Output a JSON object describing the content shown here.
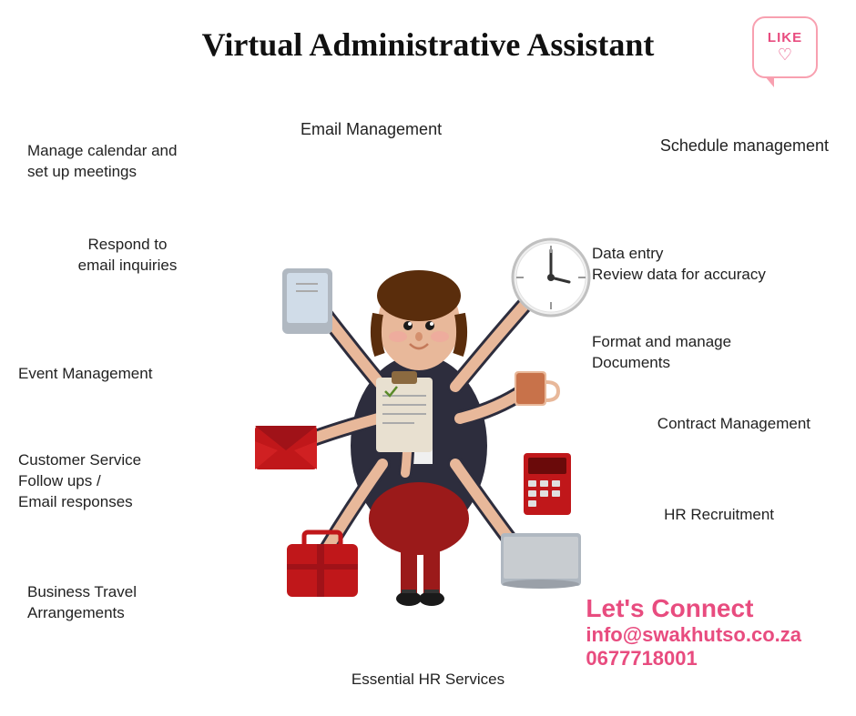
{
  "title": "Virtual Administrative Assistant",
  "like_bubble": {
    "text": "LIKE",
    "heart": "♡"
  },
  "labels": {
    "email_management": "Email Management",
    "schedule_management": "Schedule management",
    "manage_calendar": "Manage calendar and\nset up meetings",
    "respond_email": "Respond to\nemail inquiries",
    "data_entry": "Data entry\nReview data for accuracy",
    "event_management": "Event Management",
    "format_documents": "Format and manage\nDocuments",
    "customer_service": "Customer Service\nFollow ups /\nEmail responses",
    "contract_management": "Contract Management",
    "business_travel": "Business Travel\nArrangements",
    "hr_recruitment": "HR Recruitment",
    "essential_hr": "Essential HR Services"
  },
  "connect": {
    "title": "Let's Connect",
    "email": "info@swakhutso.co.za",
    "phone": "0677718001"
  },
  "colors": {
    "pink": "#e84c7f",
    "dark_red": "#8b1a1a",
    "text": "#222222"
  }
}
